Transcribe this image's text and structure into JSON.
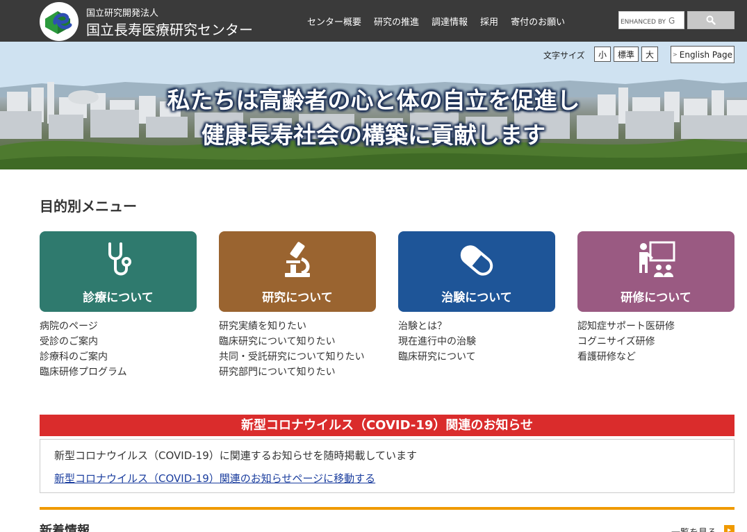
{
  "header": {
    "org_sub": "国立研究開発法人",
    "org_name": "国立長寿医療研究センター",
    "nav": [
      "センター概要",
      "研究の推進",
      "調達情報",
      "採用",
      "寄付のお願い"
    ],
    "search": {
      "placeholder": "ENHANCED BY",
      "google_mark": "G"
    }
  },
  "hero": {
    "font_size_label": "文字サイズ",
    "font_sizes": [
      "小",
      "標準",
      "大"
    ],
    "english_link": "English Page",
    "line1": "私たちは高齢者の心と体の自立を促進し",
    "line2": "健康長寿社会の構築に貢献します"
  },
  "purpose_menu": {
    "title": "目的別メニュー",
    "cards": [
      {
        "label": "診療について",
        "color": "#2f7a6e",
        "icon": "stethoscope-icon",
        "links": [
          "病院のページ",
          "受診のご案内",
          "診療科のご案内",
          "臨床研修プログラム"
        ]
      },
      {
        "label": "研究について",
        "color": "#9a6430",
        "icon": "microscope-icon",
        "links": [
          "研究実績を知りたい",
          "臨床研究について知りたい",
          "共同・受託研究について知りたい",
          "研究部門について知りたい"
        ]
      },
      {
        "label": "治験について",
        "color": "#1e5598",
        "icon": "capsule-icon",
        "links": [
          "治験とは？",
          "現在進行中の治験",
          "臨床研究について"
        ]
      },
      {
        "label": "研修について",
        "color": "#9a5a82",
        "icon": "presentation-icon",
        "links": [
          "認知症サポート医研修",
          "コグニサイズ研修",
          "看護研修など"
        ]
      }
    ]
  },
  "covid": {
    "title": "新型コロナウイルス（COVID-19）関連のお知らせ",
    "text": "新型コロナウイルス（COVID-19）に関連するお知らせを随時掲載しています",
    "link": "新型コロナウイルス（COVID-19）関連のお知らせページに移動する"
  },
  "news": {
    "title": "新着情報",
    "more": "一覧を見る"
  },
  "colors": {
    "header_bg": "#3a3a3a",
    "covid_red": "#da2c2c",
    "accent_orange": "#f09a00",
    "link_blue": "#1a3d9e"
  }
}
